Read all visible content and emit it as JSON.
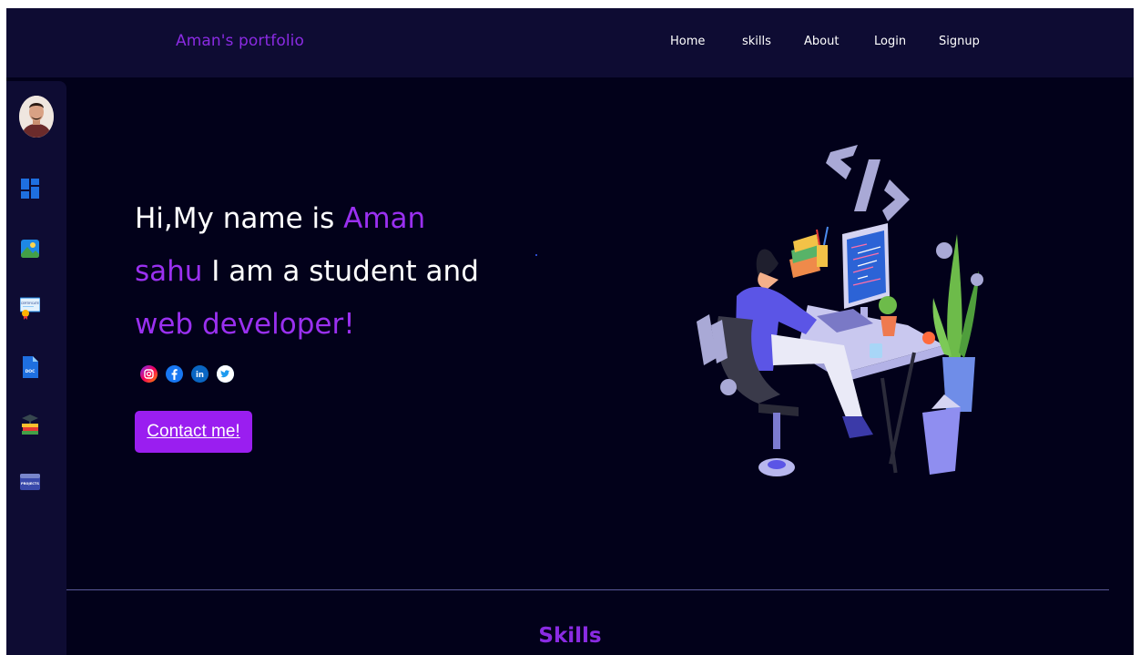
{
  "navbar": {
    "brand": "Aman's portfolio",
    "links": [
      {
        "label": "Home"
      },
      {
        "label": "skills"
      },
      {
        "label": "About"
      },
      {
        "label": "Login"
      },
      {
        "label": "Signup"
      }
    ]
  },
  "sidebar": {
    "items": [
      {
        "icon": "dashboard-icon"
      },
      {
        "icon": "gallery-icon"
      },
      {
        "icon": "certificate-icon",
        "text": "CERTIFICATE"
      },
      {
        "icon": "document-icon",
        "text": "DOC"
      },
      {
        "icon": "education-icon"
      },
      {
        "icon": "projects-icon",
        "text": "PROJECTS"
      }
    ]
  },
  "hero": {
    "line1_prefix": "Hi,My name is ",
    "line1_accent": "Aman",
    "line2_accent": "sahu",
    "line2_rest": " I am a student and",
    "line3_accent": "web developer!",
    "contact_label": "Contact me!",
    "socials": [
      "instagram-icon",
      "facebook-icon",
      "linkedin-icon",
      "twitter-icon"
    ]
  },
  "skills": {
    "title": "Skills"
  },
  "colors": {
    "background": "#02011a",
    "navbar": "#0e0c33",
    "accent": "#9a30f0",
    "button": "#9a1ef0"
  }
}
